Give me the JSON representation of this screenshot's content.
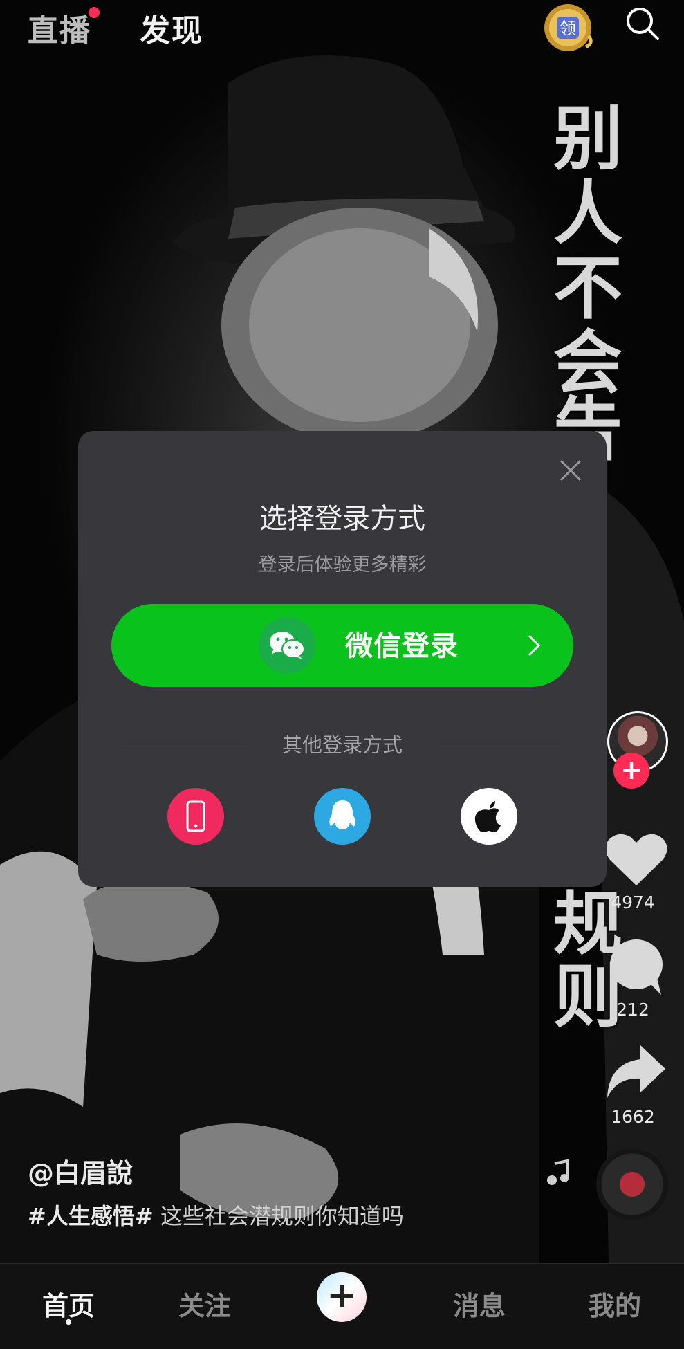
{
  "top_bar": {
    "tab_live": "直播",
    "tab_discover": "发现",
    "coin_glyph": "领"
  },
  "video": {
    "overlay_text_top": [
      "别",
      "人",
      "不",
      "会",
      "告"
    ],
    "overlay_text_bottom": [
      "规",
      "则"
    ],
    "author": "@白眉說",
    "caption_tag": "#人生感悟#",
    "caption_text": " 这些社会潜规则你知道吗"
  },
  "side_rail": {
    "follow_symbol": "+",
    "likes_count": "4974",
    "comments_count": "212",
    "shares_count": "1662"
  },
  "login_modal": {
    "title": "选择登录方式",
    "subtitle": "登录后体验更多精彩",
    "wechat_label": "微信登录",
    "other_label": "其他登录方式"
  },
  "bottom_nav": {
    "home": "首页",
    "follow": "关注",
    "create": "+",
    "messages": "消息",
    "me": "我的"
  },
  "colors": {
    "accent_pink": "#fe2c55",
    "wechat_green": "#09c21c",
    "qq_blue": "#2ca8e3",
    "modal_bg": "#38383c"
  },
  "icons": [
    "coin-icon",
    "search-icon",
    "close-icon",
    "wechat-icon",
    "chevron-right-icon",
    "phone-icon",
    "qq-icon",
    "apple-icon",
    "heart-icon",
    "comment-icon",
    "share-icon",
    "music-note-icon"
  ]
}
